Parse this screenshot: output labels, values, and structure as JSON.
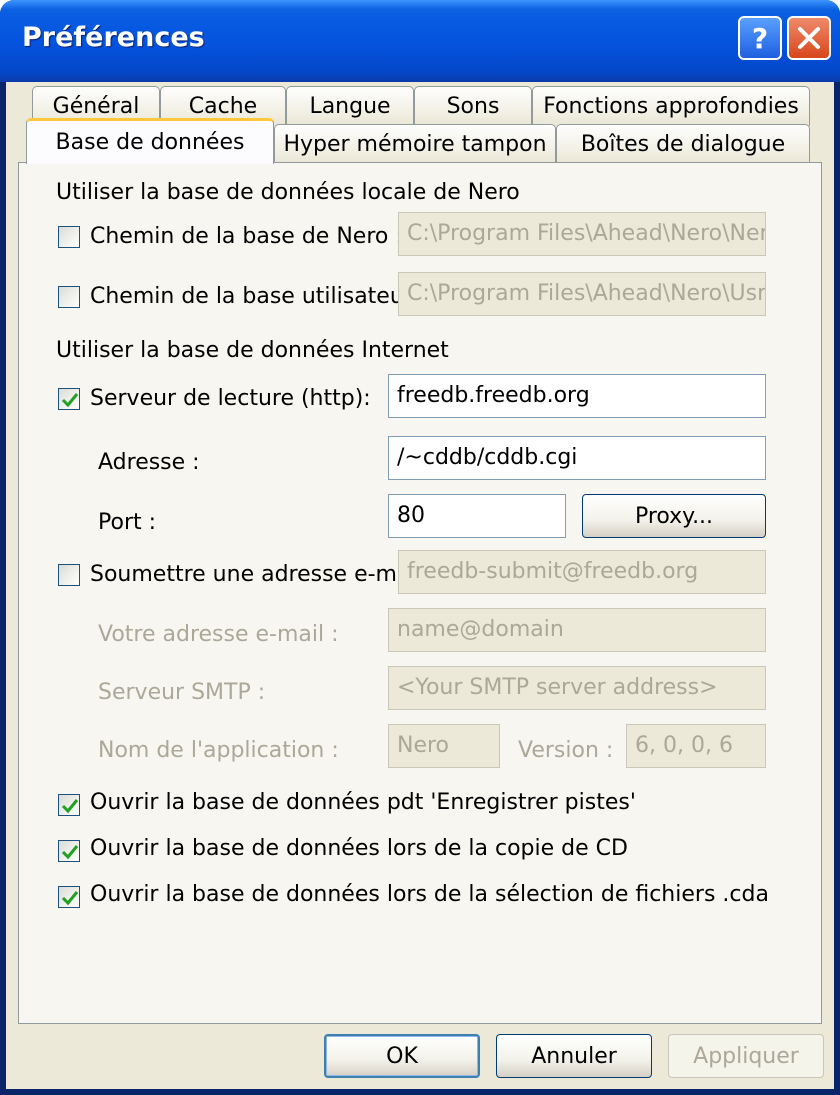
{
  "window": {
    "title": "Préférences",
    "help_glyph": "?",
    "close_glyph": "×"
  },
  "tabs_row1": [
    "Général",
    "Cache",
    "Langue",
    "Sons",
    "Fonctions approfondies"
  ],
  "tabs_row2": [
    "Base de données",
    "Hyper mémoire tampon",
    "Boîtes de dialogue"
  ],
  "active_tab": "Base de données",
  "local_db": {
    "group_label": "Utiliser la base de données locale de Nero",
    "nero_path": {
      "label": "Chemin de la base de Nero :",
      "checked": false,
      "value": "C:\\Program Files\\Ahead\\Nero\\Nero"
    },
    "user_path": {
      "label": "Chemin de la base utilisateur",
      "checked": false,
      "value": "C:\\Program Files\\Ahead\\Nero\\UsrD"
    }
  },
  "internet_db": {
    "group_label": "Utiliser la base de données Internet",
    "read_server": {
      "label": "Serveur de lecture (http):",
      "checked": true,
      "value": "freedb.freedb.org"
    },
    "address": {
      "label": "Adresse :",
      "value": "/~cddb/cddb.cgi"
    },
    "port": {
      "label": "Port :",
      "value": "80"
    },
    "proxy_button": "Proxy...",
    "submit_email": {
      "label": "Soumettre une adresse e-mai",
      "checked": false,
      "value": "freedb-submit@freedb.org"
    },
    "your_email": {
      "label": "Votre adresse e-mail :",
      "value": "name@domain"
    },
    "smtp_server": {
      "label": "Serveur SMTP :",
      "value": "<Your SMTP server address>"
    },
    "app_name": {
      "label": "Nom de l'application :",
      "value": "Nero"
    },
    "version": {
      "label": "Version :",
      "value": "6, 0, 0, 6"
    }
  },
  "options": [
    {
      "label": "Ouvrir la base de données pdt 'Enregistrer pistes'",
      "checked": true
    },
    {
      "label": "Ouvrir la base de données lors de la copie de CD",
      "checked": true
    },
    {
      "label": "Ouvrir la base de données lors de la sélection de fichiers .cda",
      "checked": true
    }
  ],
  "buttons": {
    "ok": "OK",
    "cancel": "Annuler",
    "apply": "Appliquer"
  },
  "colors": {
    "titlebar": "#0554e0",
    "face": "#ece9d8",
    "check_mark": "#21a121",
    "disabled_text": "#aca899"
  }
}
